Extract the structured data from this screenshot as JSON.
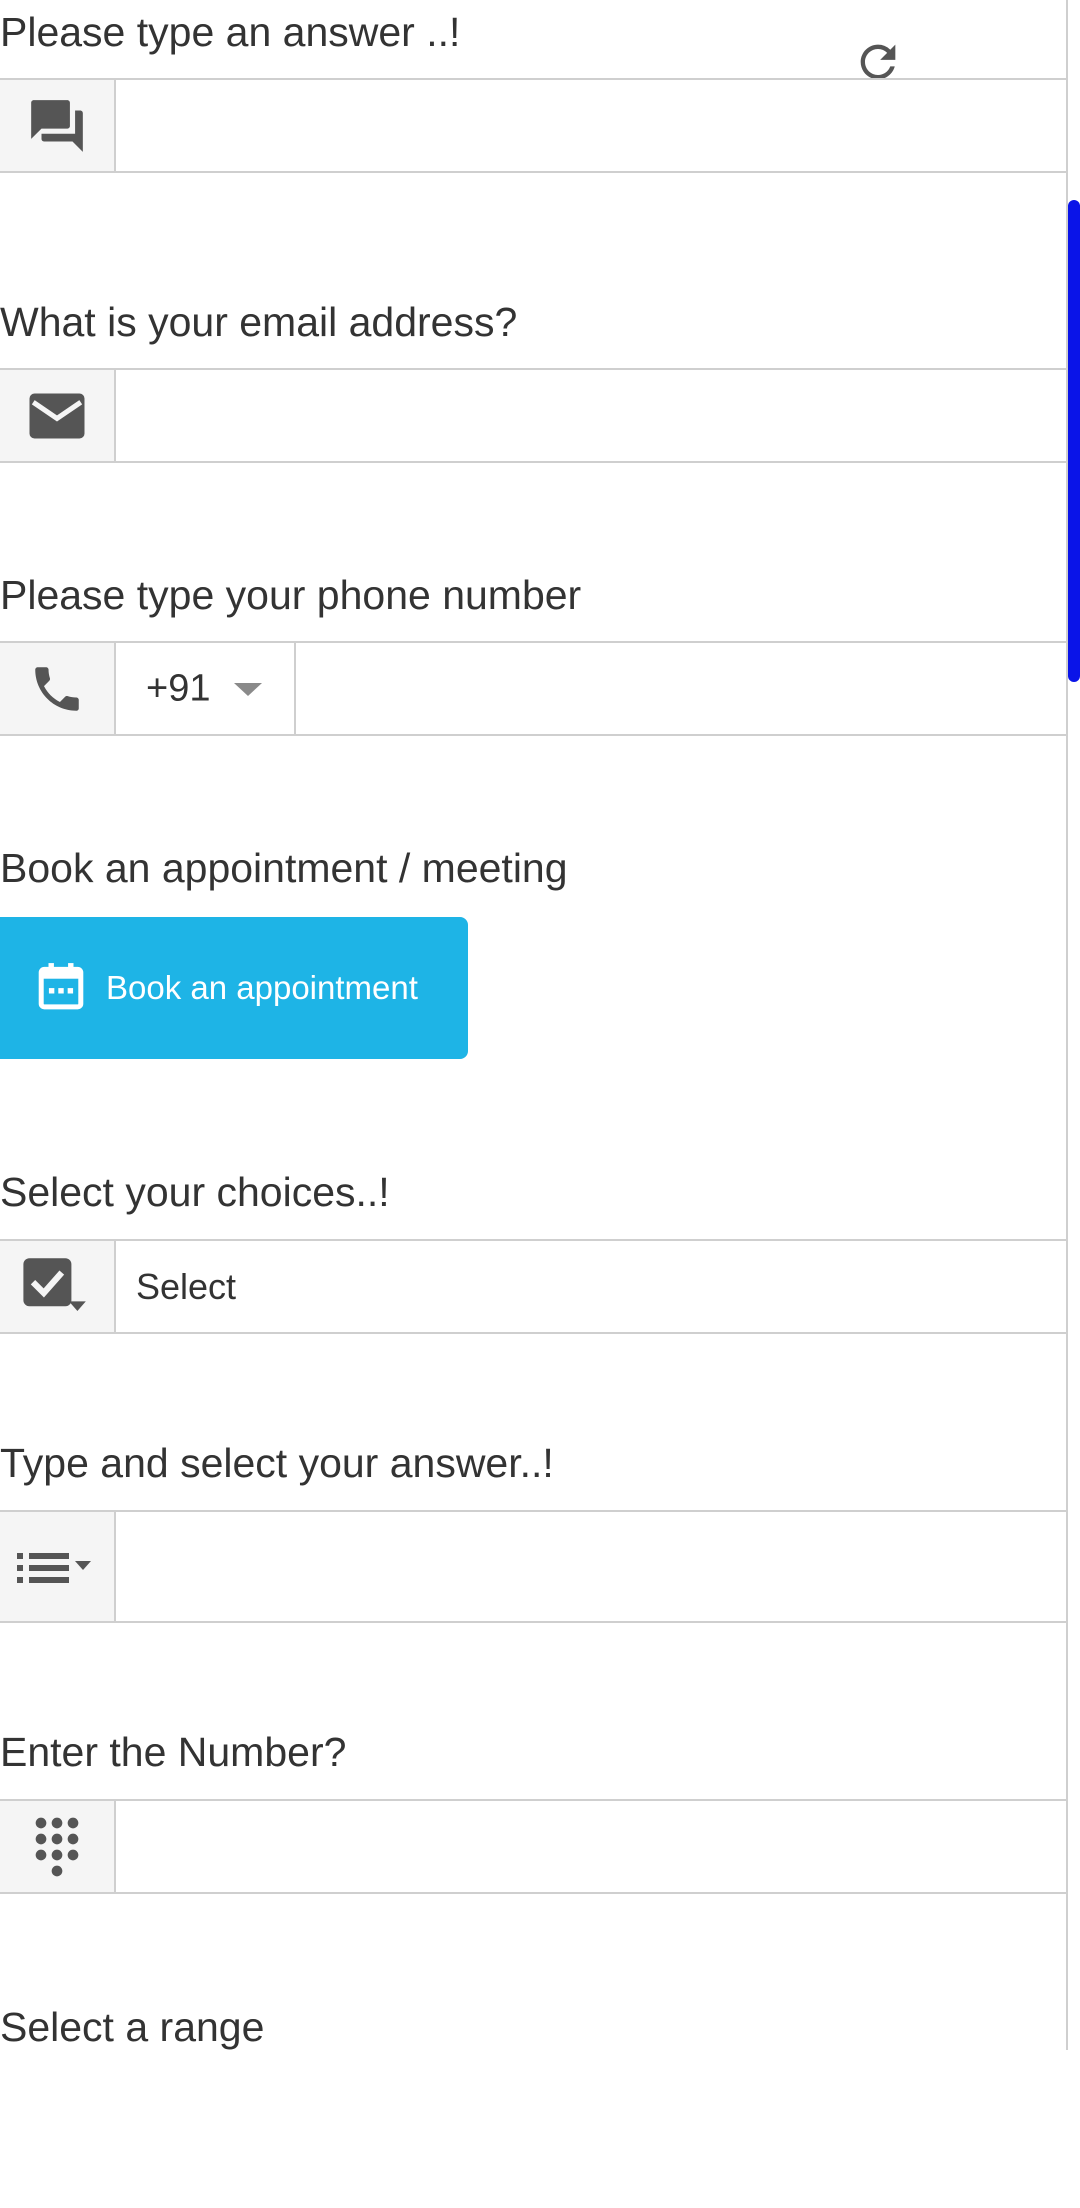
{
  "questions": {
    "answer": {
      "label": "Please type an answer ..!",
      "value": ""
    },
    "email": {
      "label": "What is your email address?",
      "value": ""
    },
    "phone": {
      "label": "Please type your phone number",
      "country_code": "+91",
      "value": ""
    },
    "appointment": {
      "label": "Book an appointment / meeting",
      "button_label": "Book an appointment"
    },
    "choices": {
      "label": "Select your choices..!",
      "selected": "Select"
    },
    "autocomplete": {
      "label": "Type and select your answer..!",
      "value": ""
    },
    "number": {
      "label": "Enter the Number?",
      "value": ""
    },
    "range": {
      "label": "Select a range"
    }
  },
  "icons": {
    "answer": "chat-icon",
    "email": "mail-icon",
    "phone": "phone-icon",
    "appointment": "calendar-icon",
    "choices": "checkbox-dropdown-icon",
    "autocomplete": "list-dropdown-icon",
    "number": "dialpad-icon",
    "refresh": "refresh-icon"
  },
  "colors": {
    "button": "#1eb4e6",
    "scrollbar": "#0a14e8",
    "icon": "#555555",
    "border": "#cfcfcf"
  }
}
